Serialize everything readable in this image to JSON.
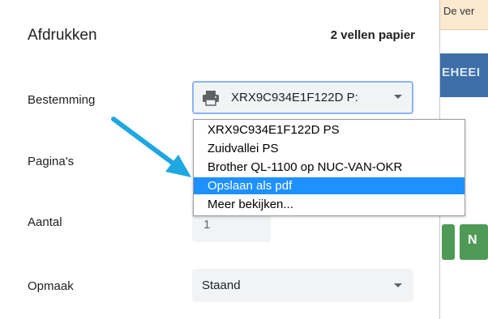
{
  "dialog": {
    "title": "Afdrukken",
    "sheets": "2 vellen papier"
  },
  "rows": {
    "destination": {
      "label": "Bestemming",
      "value": "XRX9C934E1F122D P:",
      "icon": "printer-icon"
    },
    "pages": {
      "label": "Pagina's"
    },
    "copies": {
      "label": "Aantal",
      "value": "1"
    },
    "layout": {
      "label": "Opmaak",
      "value": "Staand"
    }
  },
  "dropdown": {
    "items": [
      "XRX9C934E1F122D PS",
      "Zuidvallei PS",
      "Brother QL-1100 op NUC-VAN-OKR",
      "Opslaan als pdf",
      "Meer bekijken..."
    ],
    "selected": "Opslaan als pdf"
  },
  "background": {
    "notice": "De ver",
    "banner": "EHEEI",
    "button": "N"
  },
  "colors": {
    "selection": "#1e90ff",
    "arrow": "#1ea7e1",
    "banner": "#3d6ea8",
    "button": "#4f9a57"
  }
}
